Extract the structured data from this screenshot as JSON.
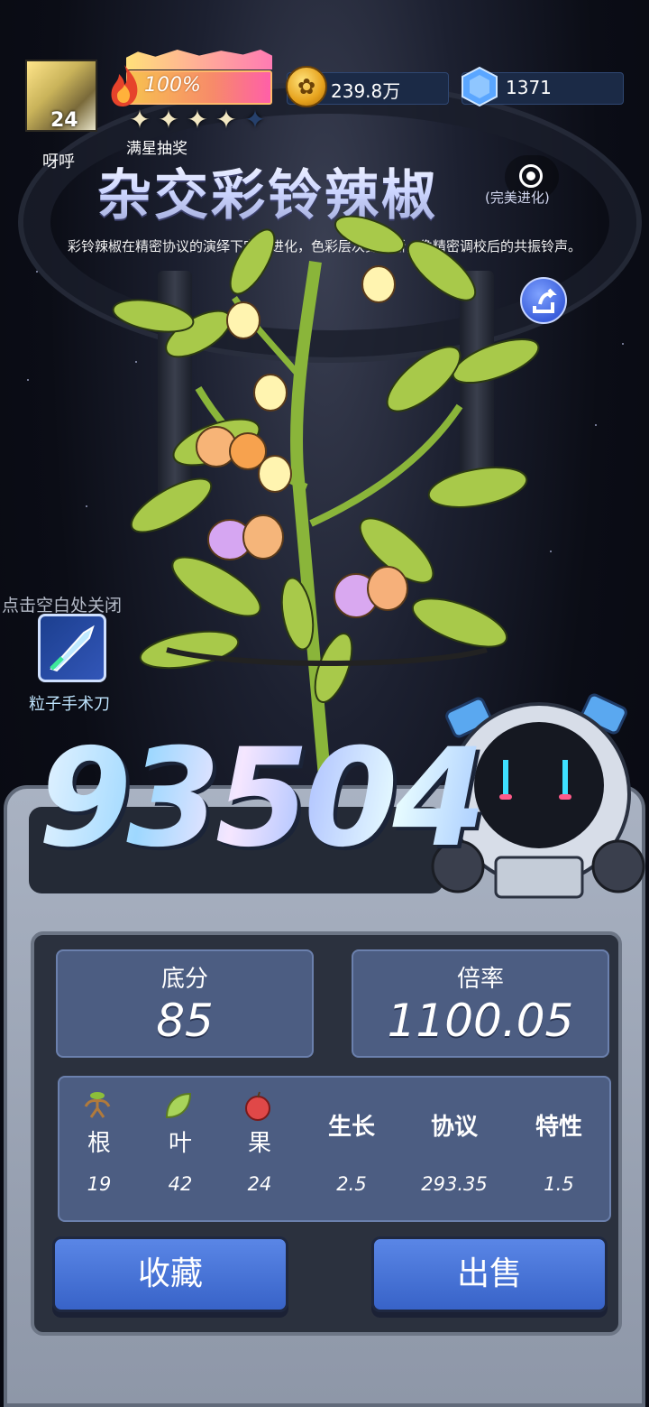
{
  "player": {
    "level": "24",
    "name": "呀呼"
  },
  "power": {
    "percent": "100%",
    "stars_filled": 4,
    "stars_total": 5,
    "full_star_label": "满星抽奖"
  },
  "currencies": {
    "coins": "239.8万",
    "gems": "1371"
  },
  "plant": {
    "name": "杂交彩铃辣椒",
    "evolution": "(完美进化)",
    "description": "彩铃辣椒在精密协议的演绎下完成进化，色彩层次更清晰，像精密调校后的共振铃声。"
  },
  "hint": {
    "close": "点击空白处关闭"
  },
  "tool": {
    "label": "粒子手术刀"
  },
  "score": "93504",
  "summary": {
    "base_label": "底分",
    "base_value": "85",
    "multiplier_label": "倍率",
    "multiplier_value": "1100.05"
  },
  "stats": {
    "columns": [
      {
        "label": "根",
        "value": "19",
        "icon": "root-icon"
      },
      {
        "label": "叶",
        "value": "42",
        "icon": "leaf-icon"
      },
      {
        "label": "果",
        "value": "24",
        "icon": "apple-icon"
      },
      {
        "label": "生长",
        "value": "2.5"
      },
      {
        "label": "协议",
        "value": "293.35"
      },
      {
        "label": "特性",
        "value": "1.5"
      }
    ]
  },
  "buttons": {
    "collect": "收藏",
    "sell": "出售"
  }
}
